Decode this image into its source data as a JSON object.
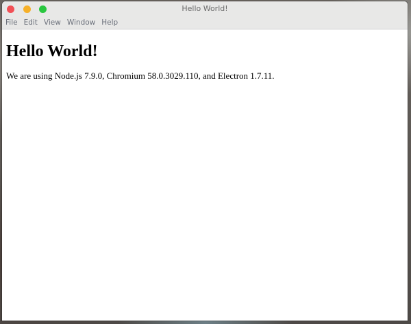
{
  "window": {
    "title": "Hello World!"
  },
  "menubar": {
    "items": [
      "File",
      "Edit",
      "View",
      "Window",
      "Help"
    ]
  },
  "content": {
    "heading": "Hello World!",
    "paragraph": "We are using Node.js 7.9.0, Chromium 58.0.3029.110, and Electron 1.7.11."
  },
  "colors": {
    "close": "#f25056",
    "minimize": "#f6b029",
    "maximize": "#29c73f",
    "titlebar": "#e8e8e7"
  }
}
